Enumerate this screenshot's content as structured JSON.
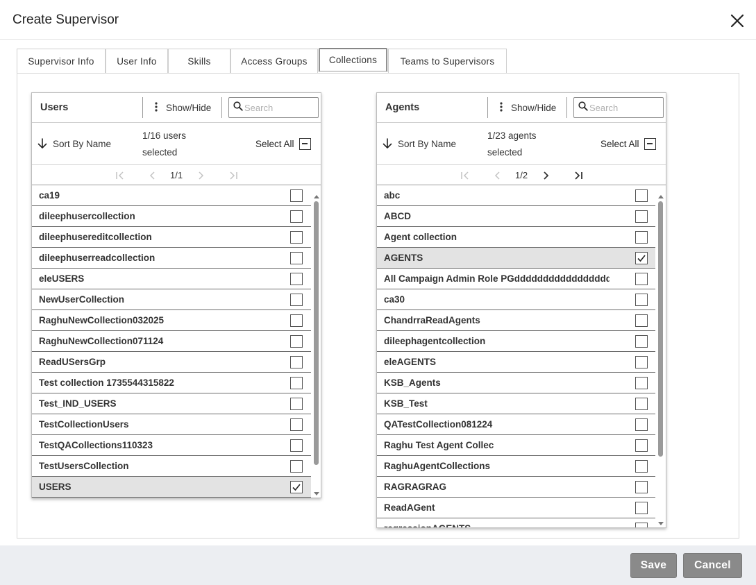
{
  "dialog": {
    "title": "Create Supervisor"
  },
  "tabs": [
    {
      "label": "Supervisor Info"
    },
    {
      "label": "User Info"
    },
    {
      "label": "Skills"
    },
    {
      "label": "Access Groups"
    },
    {
      "label": "Collections",
      "active": true
    },
    {
      "label": "Teams to Supervisors"
    }
  ],
  "users_panel": {
    "title": "Users",
    "show_hide": "Show/Hide",
    "search_placeholder": "Search",
    "sort_label": "Sort By Name",
    "count_line1": "1/16 users",
    "count_line2": "selected",
    "select_all": "Select All",
    "page": "1/1",
    "items": [
      {
        "label": "ca19",
        "checked": false
      },
      {
        "label": "dileephusercollection",
        "checked": false
      },
      {
        "label": "dileephusereditcollection",
        "checked": false
      },
      {
        "label": "dileephuserreadcollection",
        "checked": false
      },
      {
        "label": "eleUSERS",
        "checked": false
      },
      {
        "label": "NewUserCollection",
        "checked": false
      },
      {
        "label": "RaghuNewCollection032025",
        "checked": false
      },
      {
        "label": "RaghuNewCollection071124",
        "checked": false
      },
      {
        "label": "ReadUSersGrp",
        "checked": false
      },
      {
        "label": "Test collection 1735544315822",
        "checked": false
      },
      {
        "label": "Test_IND_USERS",
        "checked": false
      },
      {
        "label": "TestCollectionUsers",
        "checked": false
      },
      {
        "label": "TestQACollections110323",
        "checked": false
      },
      {
        "label": "TestUsersCollection",
        "checked": false
      },
      {
        "label": "USERS",
        "checked": true
      }
    ]
  },
  "agents_panel": {
    "title": "Agents",
    "show_hide": "Show/Hide",
    "search_placeholder": "Search",
    "sort_label": "Sort By Name",
    "count_line1": "1/23 agents",
    "count_line2": "selected",
    "select_all": "Select All",
    "page": "1/2",
    "items": [
      {
        "label": "abc",
        "checked": false
      },
      {
        "label": "ABCD",
        "checked": false
      },
      {
        "label": "Agent collection",
        "checked": false
      },
      {
        "label": "AGENTS",
        "checked": true
      },
      {
        "label": "All Campaign Admin Role PGddddddddddddddddd",
        "checked": false
      },
      {
        "label": "ca30",
        "checked": false
      },
      {
        "label": "ChandrraReadAgents",
        "checked": false
      },
      {
        "label": "dileephagentcollection",
        "checked": false
      },
      {
        "label": "eleAGENTS",
        "checked": false
      },
      {
        "label": "KSB_Agents",
        "checked": false
      },
      {
        "label": "KSB_Test",
        "checked": false
      },
      {
        "label": "QATestCollection081224",
        "checked": false
      },
      {
        "label": "Raghu Test Agent Collec",
        "checked": false
      },
      {
        "label": "RaghuAgentCollections",
        "checked": false
      },
      {
        "label": "RAGRAGRAG",
        "checked": false
      },
      {
        "label": "ReadAGent",
        "checked": false
      },
      {
        "label": "regressionAGENTS",
        "checked": false
      }
    ]
  },
  "footer": {
    "save_label": "Save",
    "cancel_label": "Cancel"
  },
  "colors": {
    "button_bg": "#8a8a8a",
    "footer_bg": "#eceef2",
    "selected_row_bg": "#e3e3e3",
    "scrollbar_thumb": "#9a9a9a"
  }
}
